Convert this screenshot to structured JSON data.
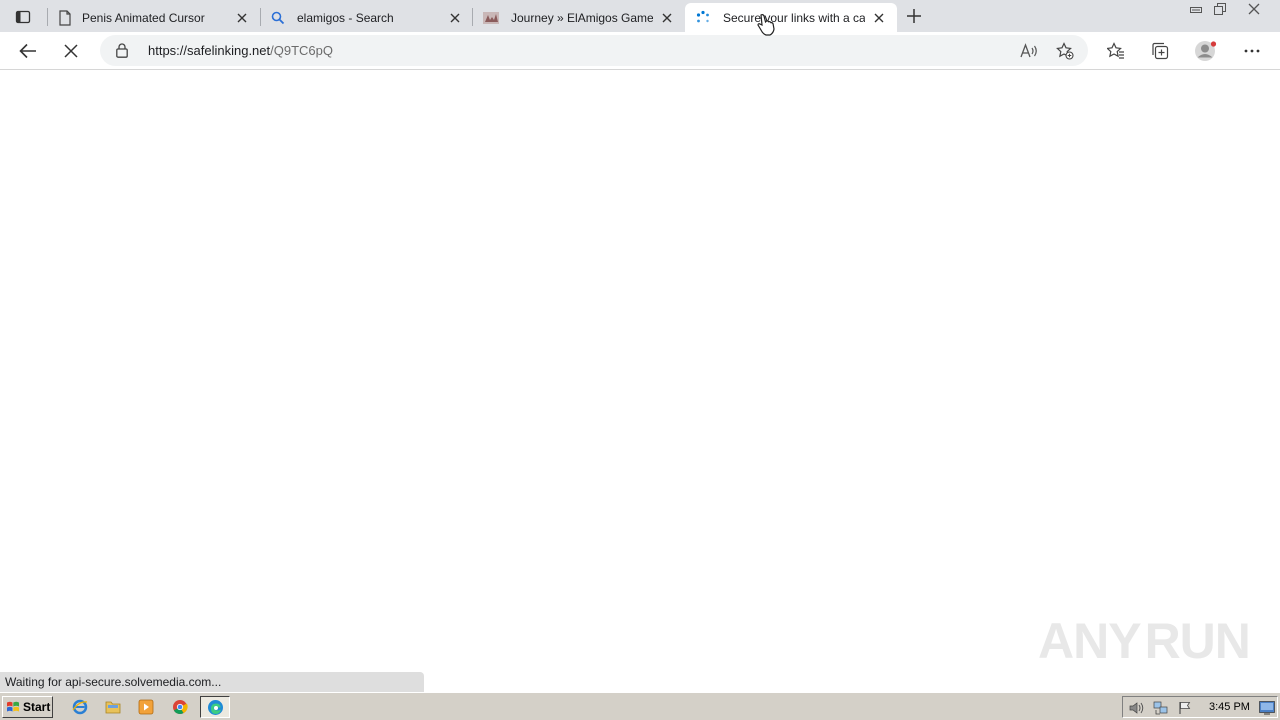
{
  "browser": {
    "tabs": [
      {
        "title": "Penis Animated Cursor",
        "icon": "page-icon"
      },
      {
        "title": "elamigos - Search",
        "icon": "search-icon"
      },
      {
        "title": "Journey » ElAmigos Games",
        "icon": "site-icon"
      },
      {
        "title": "Secure your links with a cap",
        "icon": "loading-icon",
        "active": true
      }
    ],
    "address": {
      "scheme_host": "https://safelinking.net",
      "path": "/Q9TC6pQ"
    }
  },
  "status_text": "Waiting for api-secure.solvemedia.com...",
  "watermark": {
    "left": "ANY",
    "right": "RUN"
  },
  "taskbar": {
    "start_label": "Start",
    "clock": "3:45 PM"
  },
  "colors": {
    "accent": "#0078d4",
    "tabstrip": "#dfe1e5",
    "taskbar": "#d4d0c8"
  }
}
